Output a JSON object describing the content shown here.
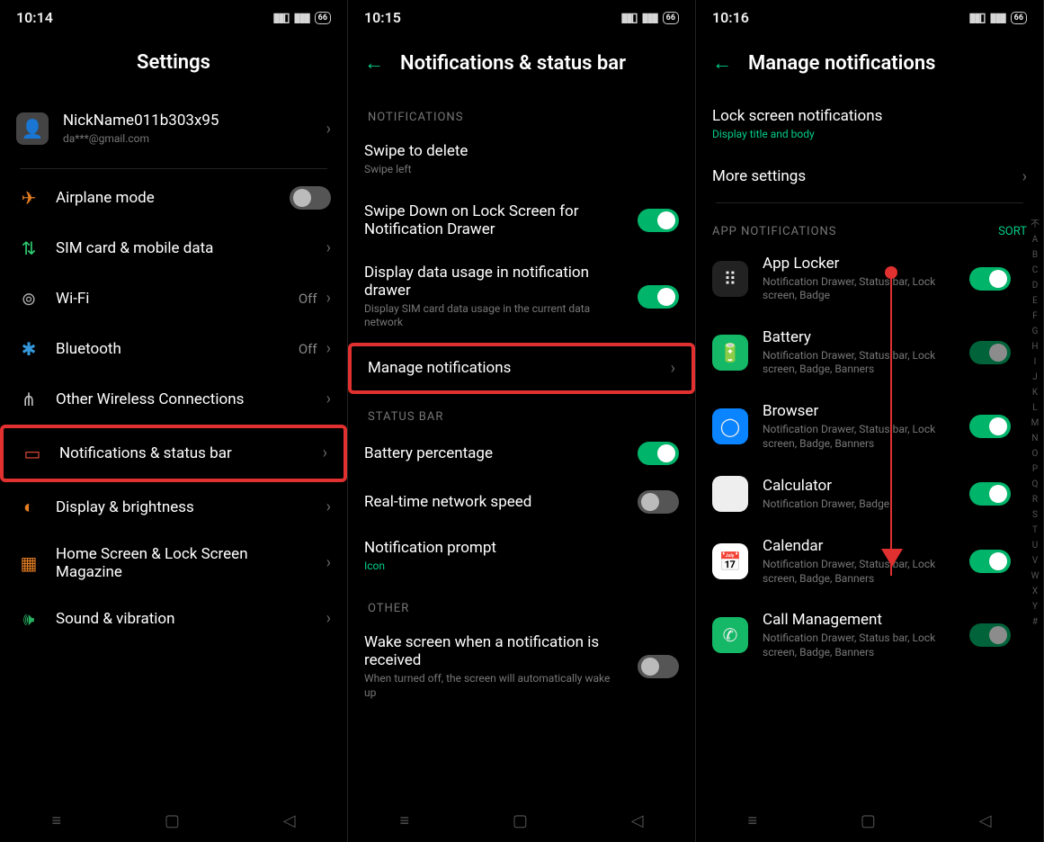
{
  "pane1": {
    "time": "10:14",
    "title": "Settings",
    "profile": {
      "name": "NickName011b303x95",
      "email": "da***@gmail.com"
    },
    "items": [
      {
        "id": "airplane",
        "label": "Airplane mode",
        "icon": "✈",
        "iconColor": "#e67e22",
        "toggle": "off"
      },
      {
        "id": "sim",
        "label": "SIM card & mobile data",
        "icon": "⇅",
        "iconColor": "#2ecc71",
        "chev": true
      },
      {
        "id": "wifi",
        "label": "Wi-Fi",
        "icon": "⊚",
        "iconColor": "#aaa",
        "value": "Off",
        "chev": true
      },
      {
        "id": "bt",
        "label": "Bluetooth",
        "icon": "✱",
        "iconColor": "#3498db",
        "value": "Off",
        "chev": true
      },
      {
        "id": "other",
        "label": "Other Wireless Connections",
        "icon": "⋔",
        "iconColor": "#bbb",
        "chev": true
      },
      {
        "id": "notif",
        "label": "Notifications & status bar",
        "icon": "▭",
        "iconColor": "#e74c3c",
        "chev": true,
        "highlight": true
      },
      {
        "id": "display",
        "label": "Display & brightness",
        "icon": "◐",
        "iconColor": "#e67e22",
        "chev": true
      },
      {
        "id": "home",
        "label": "Home Screen & Lock Screen Magazine",
        "icon": "▦",
        "iconColor": "#e67e22",
        "chev": true
      },
      {
        "id": "sound",
        "label": "Sound & vibration",
        "icon": "🕪",
        "iconColor": "#27ae60",
        "chev": true
      }
    ]
  },
  "pane2": {
    "time": "10:15",
    "title": "Notifications & status bar",
    "groups": [
      {
        "label": "NOTIFICATIONS",
        "rows": [
          {
            "id": "swipe",
            "title": "Swipe to delete",
            "sub": "Swipe left"
          },
          {
            "id": "lockswipe",
            "title": "Swipe Down on Lock Screen for Notification Drawer",
            "toggle": "on"
          },
          {
            "id": "datausage",
            "title": "Display data usage in notification drawer",
            "sub": "Display SIM card data usage in the current data network",
            "toggle": "on"
          },
          {
            "id": "manage",
            "title": "Manage notifications",
            "chev": true,
            "highlight": true
          }
        ]
      },
      {
        "label": "STATUS BAR",
        "rows": [
          {
            "id": "batt",
            "title": "Battery percentage",
            "toggle": "on"
          },
          {
            "id": "speed",
            "title": "Real-time network speed",
            "toggle": "off"
          },
          {
            "id": "prompt",
            "title": "Notification prompt",
            "sub": "Icon",
            "subStyle": "green"
          }
        ]
      },
      {
        "label": "OTHER",
        "rows": [
          {
            "id": "wake",
            "title": "Wake screen when a notification is received",
            "sub": "When turned off, the screen will automatically wake up",
            "toggle": "off"
          }
        ]
      }
    ]
  },
  "pane3": {
    "time": "10:16",
    "title": "Manage notifications",
    "lock_title": "Lock screen notifications",
    "lock_sub": "Display title and body",
    "more": "More settings",
    "list_label": "APP NOTIFICATIONS",
    "sort": "SORT",
    "apps": [
      {
        "id": "applocker",
        "name": "App Locker",
        "sub": "Notification Drawer, Status bar, Lock screen, Badge",
        "bg": "#222",
        "glyph": "⠿",
        "toggle": "on"
      },
      {
        "id": "battery",
        "name": "Battery",
        "sub": "Notification Drawer, Status bar, Lock screen, Badge, Banners",
        "bg": "#14b866",
        "glyph": "🔋",
        "toggle": "dim"
      },
      {
        "id": "browser",
        "name": "Browser",
        "sub": "Notification Drawer, Status bar, Lock screen, Badge, Banners",
        "bg": "#0a84ff",
        "glyph": "◯",
        "toggle": "on"
      },
      {
        "id": "calc",
        "name": "Calculator",
        "sub": "Notification Drawer, Badge",
        "bg": "#eee",
        "glyph": "∷",
        "toggle": "on"
      },
      {
        "id": "calendar",
        "name": "Calendar",
        "sub": "Notification Drawer, Status bar, Lock screen, Badge, Banners",
        "bg": "#fff",
        "glyph": "📅",
        "toggle": "on"
      },
      {
        "id": "call",
        "name": "Call Management",
        "sub": "Notification Drawer, Status bar, Lock screen, Badge, Banners",
        "bg": "#14b866",
        "glyph": "✆",
        "toggle": "dim"
      }
    ],
    "index": [
      "不",
      "A",
      "B",
      "C",
      "D",
      "E",
      "F",
      "G",
      "H",
      "I",
      "J",
      "K",
      "L",
      "M",
      "N",
      "O",
      "P",
      "Q",
      "R",
      "S",
      "T",
      "U",
      "V",
      "W",
      "X",
      "Y",
      "#"
    ]
  },
  "battery_label": "66"
}
